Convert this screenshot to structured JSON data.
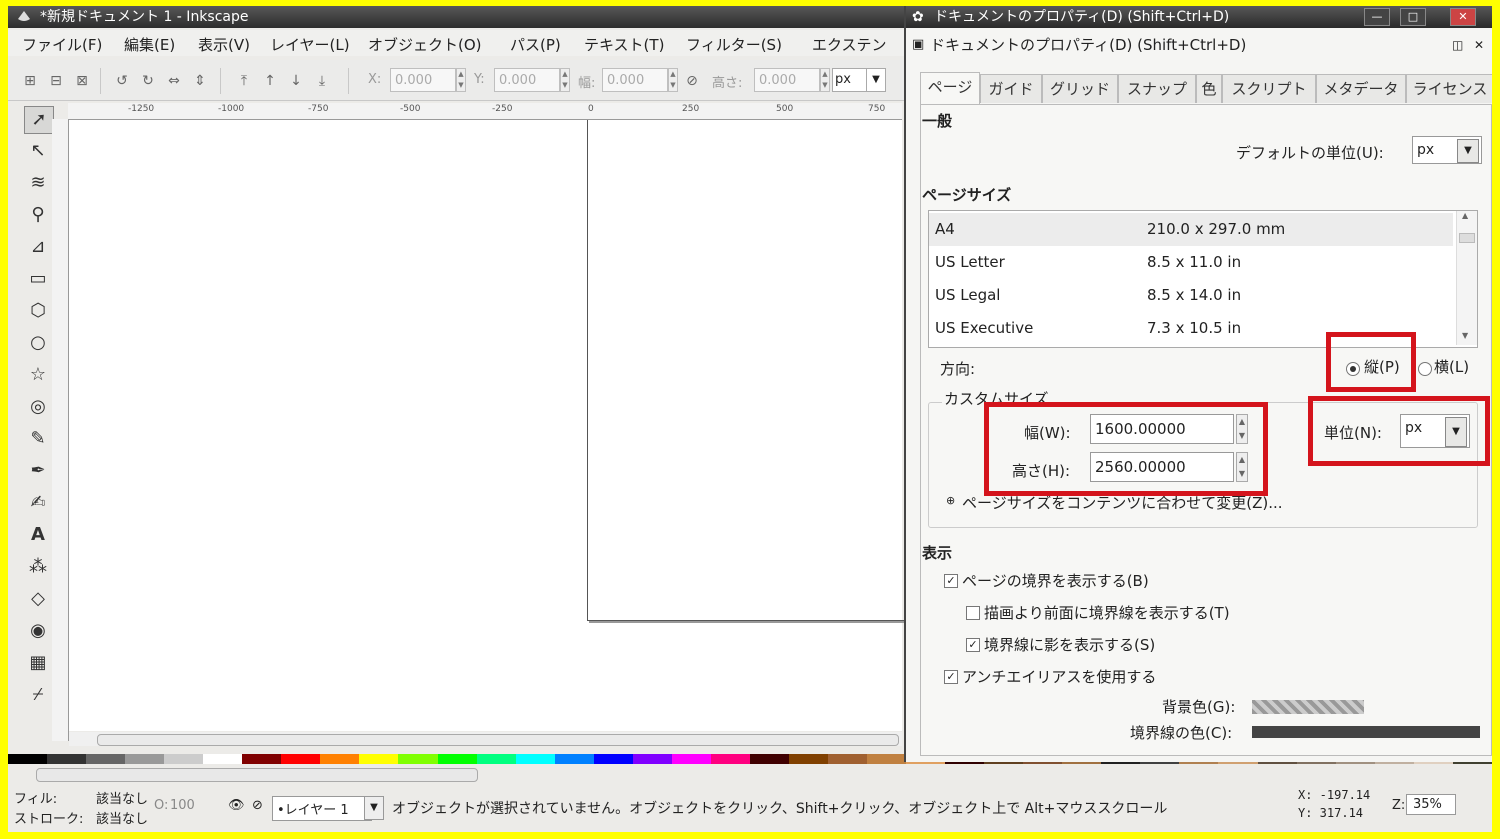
{
  "main_window": {
    "title": "*新規ドキュメント 1 - Inkscape",
    "menu": [
      "ファイル(F)",
      "編集(E)",
      "表示(V)",
      "レイヤー(L)",
      "オブジェクト(O)",
      "パス(P)",
      "テキスト(T)",
      "フィルター(S)",
      "エクステン"
    ],
    "toolbar": {
      "x_label": "X:",
      "x_value": "0.000",
      "y_label": "Y:",
      "y_value": "0.000",
      "w_label": "幅:",
      "w_value": "0.000",
      "h_label": "高さ:",
      "h_value": "0.000",
      "unit": "px"
    },
    "ruler_ticks": [
      "-1250",
      "-1000",
      "-750",
      "-500",
      "-250",
      "0",
      "250",
      "500",
      "750"
    ]
  },
  "status_bar": {
    "fill_label": "フィル:",
    "fill_value": "該当なし",
    "stroke_label": "ストローク:",
    "stroke_value": "該当なし",
    "opacity_label": "O:",
    "opacity_value": "100",
    "layer": "•レイヤー 1",
    "message": "オブジェクトが選択されていません。オブジェクトをクリック、Shift+クリック、オブジェクト上で Alt+マウススクロール",
    "x_coord": "X: -197.14",
    "y_coord": "Y:  317.14",
    "zoom_label": "Z:",
    "zoom": "35%"
  },
  "dialog": {
    "title": "ドキュメントのプロパティ(D) (Shift+Ctrl+D)",
    "subtitle": "ドキュメントのプロパティ(D) (Shift+Ctrl+D)",
    "tabs": [
      "ページ",
      "ガイド",
      "グリッド",
      "スナップ",
      "色",
      "スクリプト",
      "メタデータ",
      "ライセンス"
    ],
    "section_general": "一般",
    "default_unit_label": "デフォルトの単位(U):",
    "default_unit": "px",
    "section_page_size": "ページサイズ",
    "page_sizes": [
      {
        "name": "A4",
        "size": "210.0 x 297.0 mm"
      },
      {
        "name": "US Letter",
        "size": "8.5 x 11.0 in"
      },
      {
        "name": "US Legal",
        "size": "8.5 x 14.0 in"
      },
      {
        "name": "US Executive",
        "size": "7.3 x 10.5 in"
      }
    ],
    "orientation_label": "方向:",
    "portrait_label": "縦(P)",
    "landscape_label": "横(L)",
    "custom_size_label": "カスタムサイズ",
    "width_label": "幅(W):",
    "width_value": "1600.00000",
    "height_label": "高さ(H):",
    "height_value": "2560.00000",
    "unit_label": "単位(N):",
    "unit_value": "px",
    "fit_label": "ページサイズをコンテンツに合わせて変更(Z)...",
    "section_display": "表示",
    "checks": [
      {
        "label": "ページの境界を表示する(B)",
        "checked": true
      },
      {
        "label": "描画より前面に境界線を表示する(T)",
        "checked": false
      },
      {
        "label": "境界線に影を表示する(S)",
        "checked": true
      },
      {
        "label": "アンチエイリアスを使用する",
        "checked": true
      }
    ],
    "bg_color_label": "背景色(G):",
    "border_color_label": "境界線の色(C):"
  },
  "highlight_color": "#d4141c"
}
